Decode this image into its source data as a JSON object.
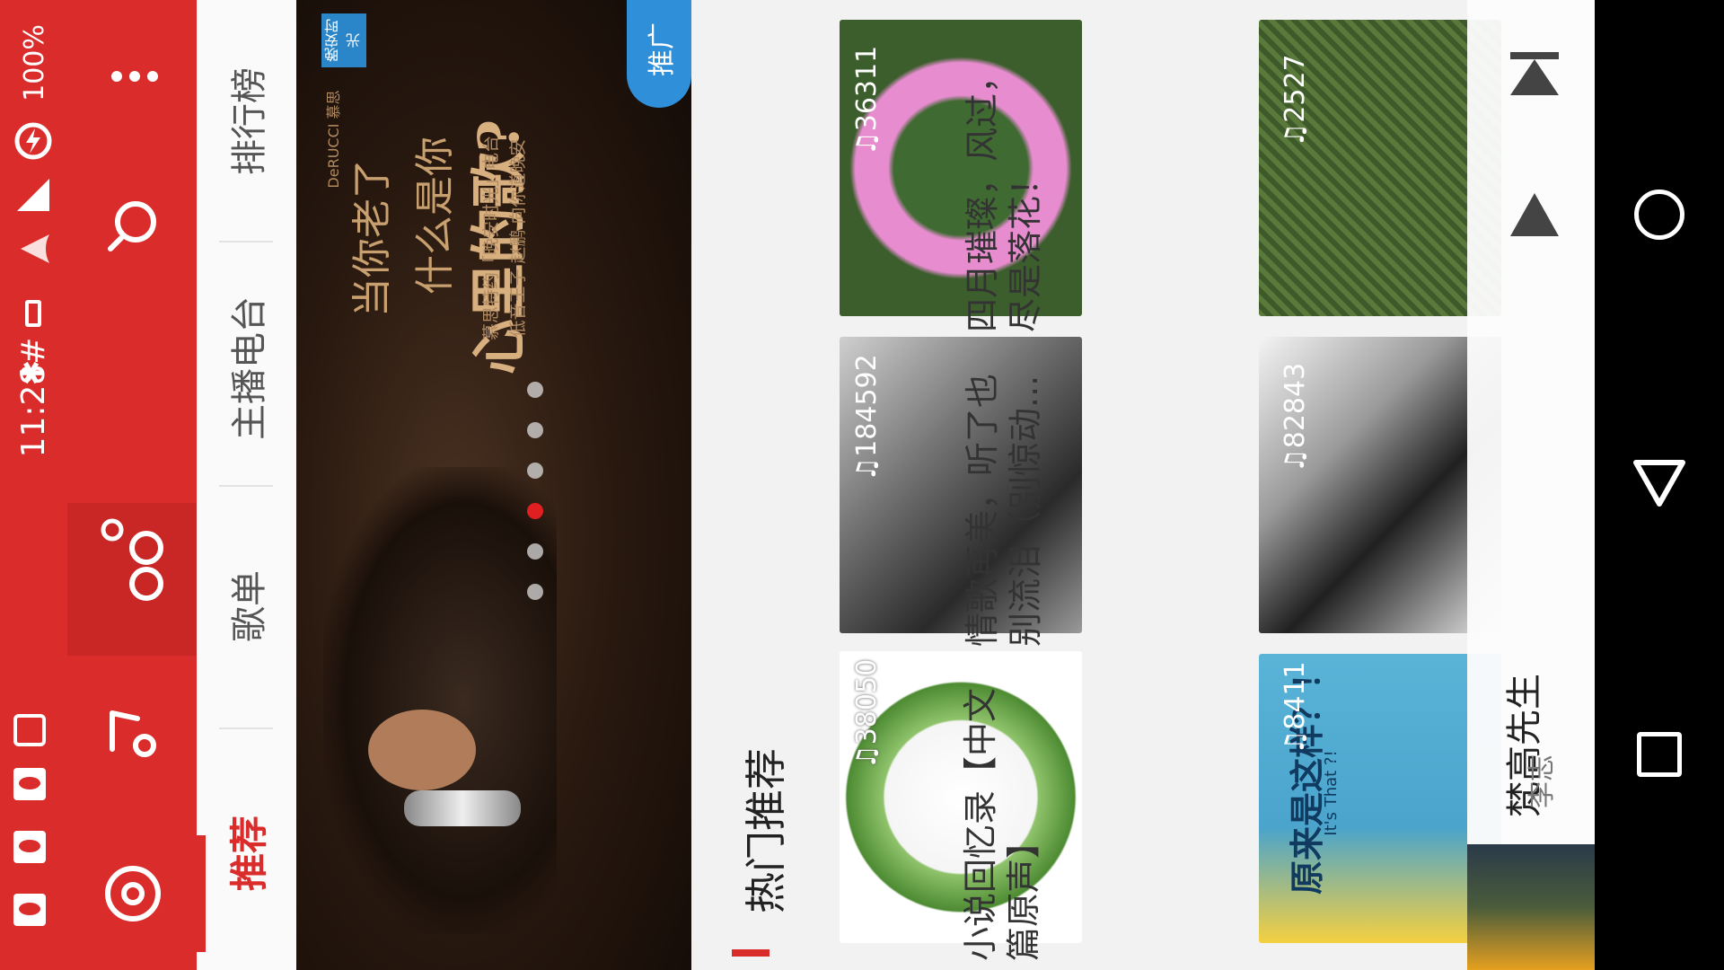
{
  "status_bar": {
    "time": "11:28",
    "time_suffix": "#",
    "battery": "100%",
    "icons": [
      "record-icon",
      "app-notification-icon",
      "app-notification-icon",
      "app-notification-icon",
      "bluetooth-icon",
      "vibrate-icon",
      "wifi-icon",
      "signal-icon",
      "battery-charging-icon"
    ]
  },
  "toolbar": {
    "icons": [
      "music-disc-icon",
      "music-note-icon",
      "friends-icon",
      "search-icon",
      "more-icon"
    ]
  },
  "tabs": [
    {
      "label": "推荐",
      "active": true
    },
    {
      "label": "歌单",
      "active": false
    },
    {
      "label": "主播电台",
      "active": false
    },
    {
      "label": "排行榜",
      "active": false
    }
  ],
  "banner": {
    "line1": "当你老了",
    "line2": "什么是你",
    "line3": "心里的歌?",
    "sub1": "慕思特约「晚安时光」电台",
    "sub2": "低音王子 赵鹏 向你道晚安",
    "brand": "DeRUCCI 慕思",
    "logo_text": "晚安时光",
    "tag": "推广",
    "dots": 6,
    "active_dot": 3
  },
  "section": {
    "title": "热门推荐"
  },
  "playlists": [
    {
      "count": "38050",
      "title": "小说回忆录【中文篇原声】"
    },
    {
      "count": "184592",
      "title": "情歌再美，听了也别流泪（别惊动..."
    },
    {
      "count": "36311",
      "title": "四月璀璨，风过，尽是落花！"
    },
    {
      "count": "8411",
      "cover_text": "原来是这样？！",
      "cover_sub": "It's That ?!"
    },
    {
      "count": "82843"
    },
    {
      "count": "2527"
    }
  ],
  "player": {
    "song": "梵高先生",
    "artist": "李志"
  },
  "nav": {
    "icons": [
      "recent-apps-icon",
      "back-icon",
      "home-icon"
    ]
  },
  "colors": {
    "accent": "#db2c2c",
    "banner_tag": "#2f8fd8"
  }
}
